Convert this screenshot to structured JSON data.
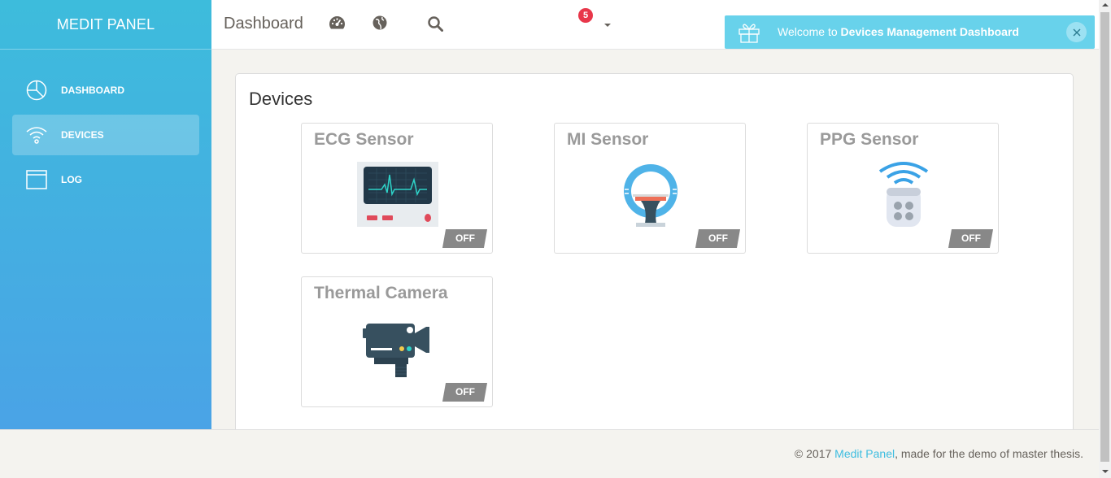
{
  "brand": "MEDIT PANEL",
  "sidebar": {
    "items": [
      {
        "label": "DASHBOARD",
        "icon": "pie-chart-icon",
        "active": false
      },
      {
        "label": "DEVICES",
        "icon": "wifi-icon",
        "active": true
      },
      {
        "label": "LOG",
        "icon": "window-icon",
        "active": false
      }
    ]
  },
  "navbar": {
    "title": "Dashboard",
    "notification_count": "5"
  },
  "notification": {
    "prefix": "Welcome to ",
    "highlight": "Devices Management Dashboard"
  },
  "card": {
    "title": "Devices",
    "devices": [
      {
        "name": "ECG Sensor",
        "status": "OFF",
        "icon": "ecg-monitor-icon"
      },
      {
        "name": "MI Sensor",
        "status": "OFF",
        "icon": "mi-sensor-icon"
      },
      {
        "name": "PPG Sensor",
        "status": "OFF",
        "icon": "ppg-sensor-icon"
      },
      {
        "name": "Thermal Camera",
        "status": "OFF",
        "icon": "camera-icon"
      }
    ]
  },
  "footer": {
    "prefix": "© 2017 ",
    "link": "Medit Panel",
    "suffix": ", made for the demo of master thesis."
  },
  "colors": {
    "sidebar_top": "#3dbcdc",
    "sidebar_bottom": "#4aa3e6",
    "notification_bg": "#68d2eb",
    "badge": "#e8374a",
    "status_off": "#888888",
    "link": "#3ebde0"
  }
}
